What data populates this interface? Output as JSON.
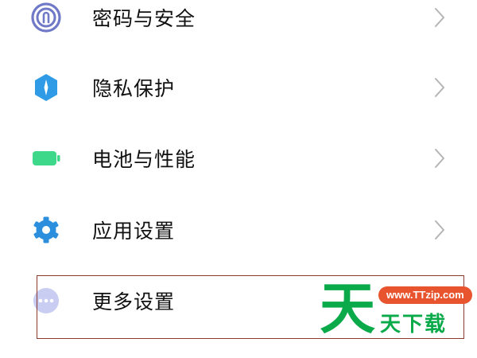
{
  "settings": {
    "items": [
      {
        "label": "密码与安全",
        "icon": "fingerprint-icon",
        "icon_color": "#6f79c8",
        "has_chevron": true
      },
      {
        "label": "隐私保护",
        "icon": "privacy-shield-icon",
        "icon_color": "#2f9be6",
        "has_chevron": true
      },
      {
        "label": "电池与性能",
        "icon": "battery-icon",
        "icon_color": "#3dd889",
        "has_chevron": true
      },
      {
        "label": "应用设置",
        "icon": "gear-icon",
        "icon_color": "#2b8fde",
        "has_chevron": true
      },
      {
        "label": "更多设置",
        "icon": "more-dots-icon",
        "icon_color": "#c9cdf2",
        "has_chevron": false
      }
    ],
    "chevron_color": "#b4b4b4",
    "highlight_color": "#8a3a2f"
  },
  "watermark": {
    "big_char": "天",
    "url": "www.TTzip.com",
    "sub_text": "天下载",
    "green": "#0aaa4a",
    "badge_color": "#e8542e"
  }
}
